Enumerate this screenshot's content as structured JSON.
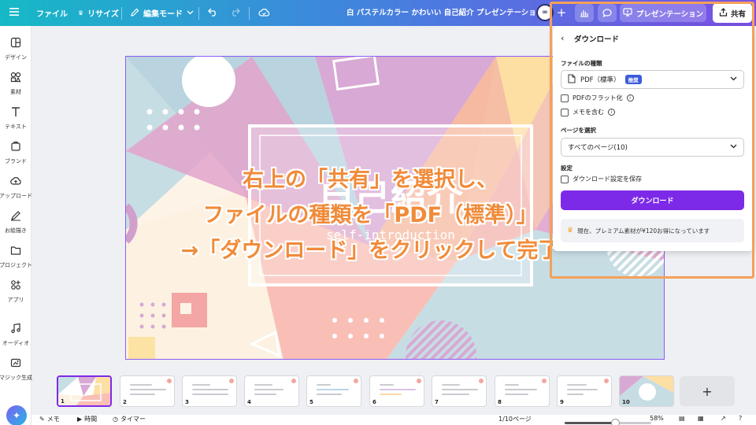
{
  "topbar": {
    "file": "ファイル",
    "resize": "リサイズ",
    "edit_mode": "編集モード",
    "doc_title": "白 パステルカラー かわいい 自己紹介 プレゼンテーション",
    "present": "プレゼンテーション",
    "share": "共有"
  },
  "sidebar": {
    "items": [
      {
        "label": "デザイン",
        "icon": "layout-icon"
      },
      {
        "label": "素材",
        "icon": "elements-icon"
      },
      {
        "label": "テキスト",
        "icon": "text-icon"
      },
      {
        "label": "ブランド",
        "icon": "brand-icon"
      },
      {
        "label": "アップロード",
        "icon": "upload-icon"
      },
      {
        "label": "お絵描き",
        "icon": "draw-icon"
      },
      {
        "label": "プロジェクト",
        "icon": "folder-icon"
      },
      {
        "label": "アプリ",
        "icon": "apps-icon"
      },
      {
        "label": "オーディオ",
        "icon": "music-icon"
      },
      {
        "label": "マジック生成",
        "icon": "magic-icon"
      }
    ]
  },
  "slide": {
    "title": "自己紹介",
    "subtitle": "self-introduction"
  },
  "caption": {
    "line1": "右上の「共有」を選択し、",
    "line2": "ファイルの種類を「PDF（標準）」",
    "line3": "→「ダウンロード」をクリックして完了"
  },
  "panel": {
    "title": "ダウンロード",
    "file_type_label": "ファイルの種類",
    "file_type_value": "PDF（標準）",
    "file_type_badge": "推奨",
    "flatten_pdf": "PDFのフラット化",
    "include_notes": "メモを含む",
    "page_select_label": "ページを選択",
    "page_select_value": "すべてのページ(10)",
    "settings_label": "設定",
    "save_settings": "ダウンロード設定を保存",
    "download_button": "ダウンロード",
    "promo": "現在、プレミアム素材が¥120お得になっています"
  },
  "thumbnails": [
    "1",
    "2",
    "3",
    "4",
    "5",
    "6",
    "7",
    "8",
    "9",
    "10"
  ],
  "bottombar": {
    "notes": "メモ",
    "duration": "時間",
    "timer": "タイマー",
    "page_indicator": "1/10ページ",
    "zoom": "58%",
    "zoom_fraction": 0.58
  },
  "colors": {
    "accent": "#7d2ae8",
    "caption": "#f08b3a",
    "highlight": "#f5a05a"
  }
}
